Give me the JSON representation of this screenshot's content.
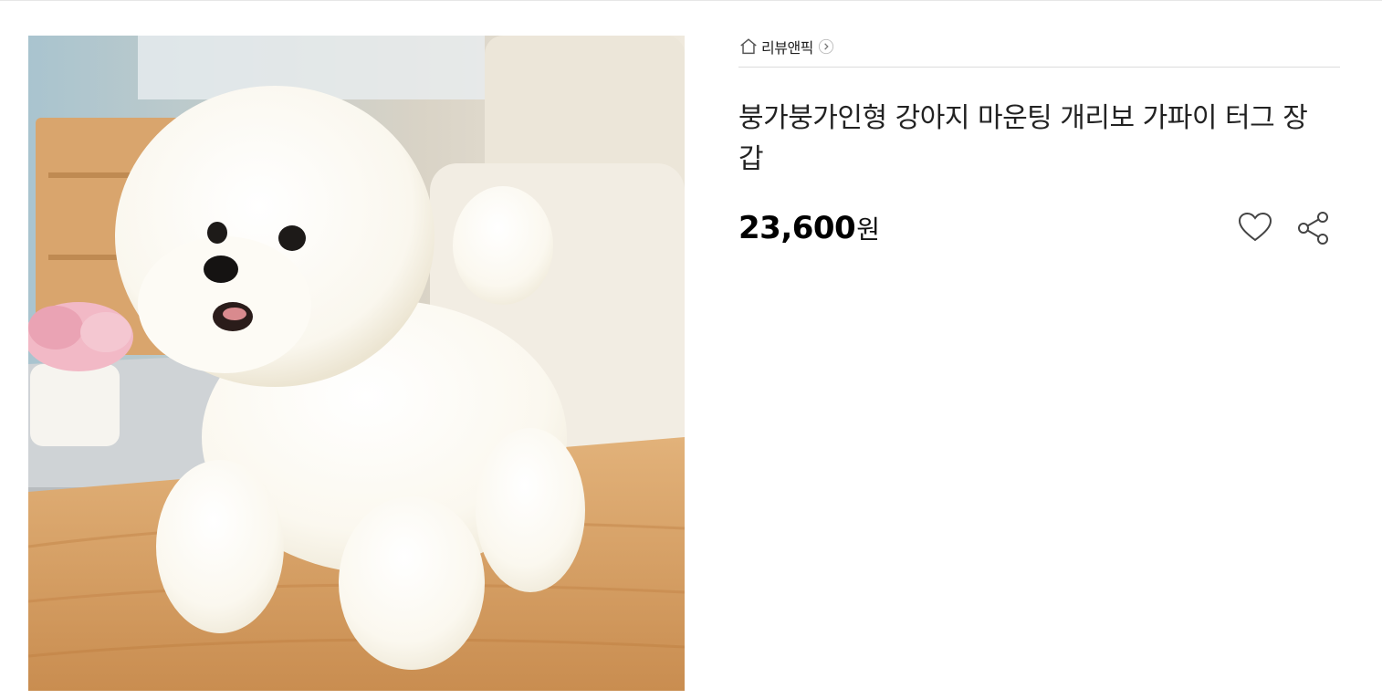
{
  "product": {
    "image_alt": "흰색 비숑 강아지 인형",
    "breadcrumb": {
      "home_icon": "home-icon",
      "store_name": "리뷰앤픽",
      "arrow_icon": "chevron-right-icon"
    },
    "title": "붕가붕가인형 강아지 마운팅 개리보 가파이 터그 장갑",
    "price": "23,600",
    "currency": "원",
    "actions": {
      "like_icon": "heart-icon",
      "share_icon": "share-icon"
    }
  }
}
